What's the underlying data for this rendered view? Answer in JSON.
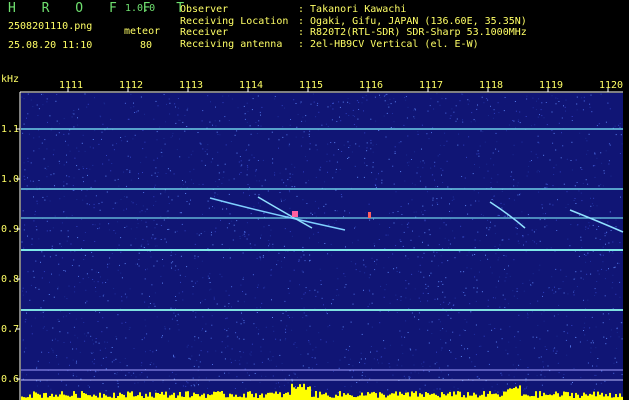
{
  "app": {
    "logo": "H R O F F T",
    "version": "1.0.0"
  },
  "file": {
    "name": "2508201110.png",
    "datetime": "25.08.20 11:10"
  },
  "meteor": {
    "label": "meteor",
    "count": "80"
  },
  "info": [
    {
      "key": "Observer",
      "value": ": Takanori Kawachi"
    },
    {
      "key": "Receiving Location",
      "value": ": Ogaki, Gifu, JAPAN (136.60E, 35.35N)"
    },
    {
      "key": "Receiver",
      "value": ": R820T2(RTL-SDR) SDR-Sharp 53.1000MHz"
    },
    {
      "key": "Receiving antenna",
      "value": ": 2el-HB9CV Vertical (el. E-W)"
    }
  ],
  "axis": {
    "y_unit": "kHz",
    "y_ticks": [
      "1.1",
      "1.0",
      "0.9",
      "0.8",
      "0.7",
      "0.6"
    ],
    "x_ticks": [
      "1111",
      "1112",
      "1113",
      "1114",
      "1115",
      "1116",
      "1117",
      "1118",
      "1119",
      "1120"
    ]
  },
  "colors": {
    "background": "#000000",
    "plot_bg": "#101575",
    "text": "#ffff66",
    "logo": "#6fe06f",
    "carrier_line": "#7fe0e0",
    "noise_bar": "#ffff00"
  }
}
